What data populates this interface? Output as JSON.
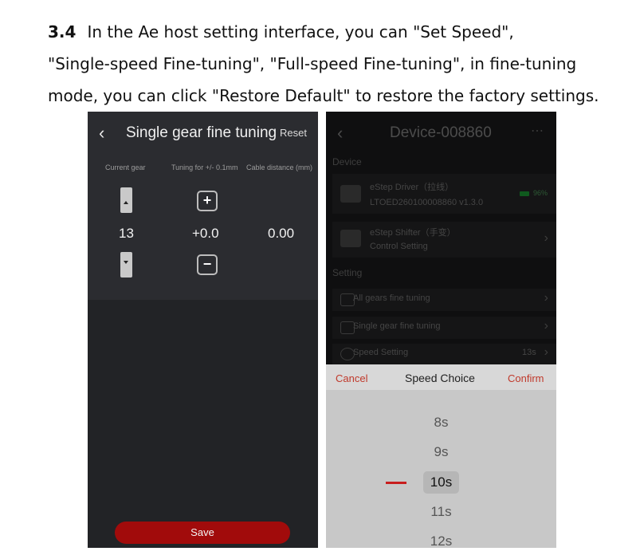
{
  "doc": {
    "section": "3.4",
    "lines": [
      "In the Ae host setting interface, you can \"Set Speed\",",
      "\"Single-speed Fine-tuning\", \"Full-speed Fine-tuning\", in fine-tuning",
      "mode, you can click \"Restore Default\" to restore the factory settings."
    ]
  },
  "left_screen": {
    "back_icon": "chevron-left-icon",
    "title": "Single gear fine tuning",
    "reset_label": "Reset",
    "columns": [
      "Current gear",
      "Tuning for +/- 0.1mm",
      "Cable distance (mm)"
    ],
    "plus_label": "+",
    "minus_label": "−",
    "current_gear": "13",
    "tuning": "+0.0",
    "cable_distance": "0.00",
    "save_label": "Save",
    "accent": "#a10b0b"
  },
  "right_screen": {
    "back_icon": "chevron-left-icon",
    "title": "Device-008860",
    "more_icon": "more-dots-icon",
    "device_section": "Device",
    "driver_name": "eStep Driver（拉线）",
    "driver_id": "LTOED260100008860  v1.3.0",
    "battery": "96%",
    "shifter_name": "eStep Shifter（手变）",
    "shifter_sub": "Control Setting",
    "setting_section": "Setting",
    "settings": [
      {
        "label": "All gears fine tuning",
        "value": ""
      },
      {
        "label": "Single gear fine tuning",
        "value": ""
      },
      {
        "label": "Speed Setting",
        "value": "13s"
      }
    ],
    "sheet": {
      "cancel": "Cancel",
      "title": "Speed Choice",
      "confirm": "Confirm",
      "options": [
        "8s",
        "9s",
        "10s",
        "11s",
        "12s"
      ],
      "selected": "10s",
      "accent": "#c0392b"
    }
  }
}
